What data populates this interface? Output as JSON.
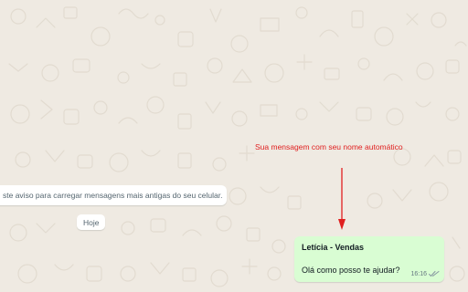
{
  "chat": {
    "older_messages_notice": "ste aviso para carregar mensagens mais antigas do seu celular.",
    "date_separator": "Hoje"
  },
  "annotation": {
    "text": "Sua mensagem com seu nome automático",
    "color": "#e02020"
  },
  "message": {
    "sender": "Letícia - Vendas",
    "text": "Olá como posso te ajudar?",
    "time": "16:16",
    "status_icon": "double-check-icon",
    "bubble_color": "#d9fdd3"
  },
  "colors": {
    "chat_background": "#efeae2",
    "doodle": "#e4ddd3"
  }
}
